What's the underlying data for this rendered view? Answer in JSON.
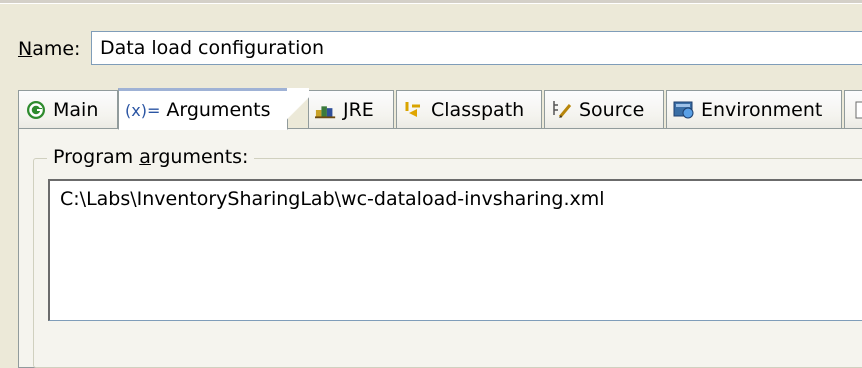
{
  "name": {
    "label_prefix": "",
    "label_mnemonic": "N",
    "label_rest": "ame:",
    "value": "Data load configuration"
  },
  "tabs": [
    {
      "label": "Main",
      "icon": "main-launch-icon",
      "active": false
    },
    {
      "label": "Arguments",
      "icon": "arguments-icon",
      "prefix": "(x)=",
      "active": true
    },
    {
      "label": "JRE",
      "icon": "jre-books-icon",
      "active": false
    },
    {
      "label": "Classpath",
      "icon": "classpath-icon",
      "active": false
    },
    {
      "label": "Source",
      "icon": "source-icon",
      "active": false
    },
    {
      "label": "Environment",
      "icon": "environment-icon",
      "active": false
    }
  ],
  "arguments_tab": {
    "program_arguments_label_pre": "Program ",
    "program_arguments_mnemonic": "a",
    "program_arguments_label_post": "rguments:",
    "program_arguments_value": "C:\\Labs\\InventorySharingLab\\wc-dataload-invsharing.xml"
  },
  "colors": {
    "window_bg": "#ece9d8",
    "input_border": "#7f9db9",
    "active_tab_accent": "#9fb2d5"
  }
}
